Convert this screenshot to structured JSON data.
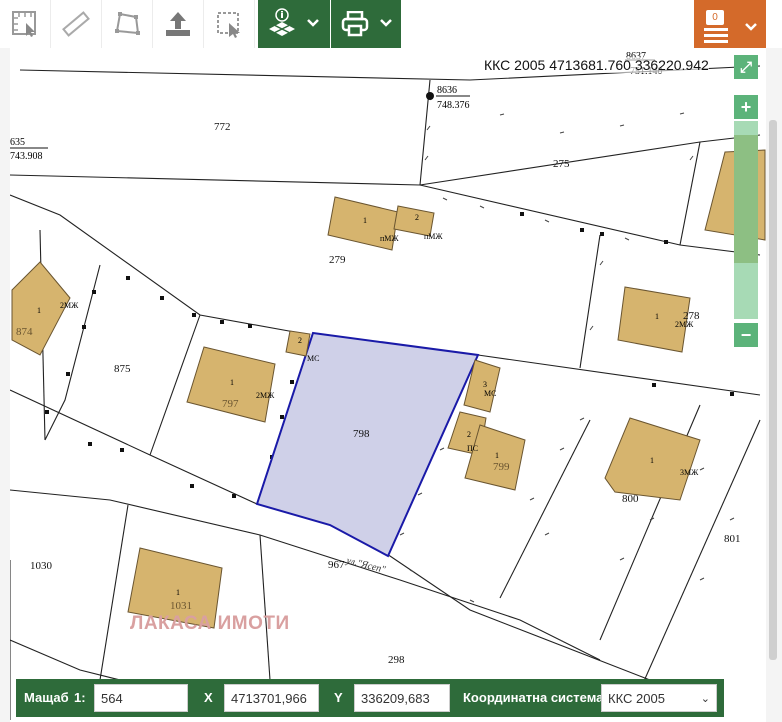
{
  "toolbar": {
    "notification_count": "0",
    "icons": [
      "measure-area-icon",
      "ruler-icon",
      "polygon-icon",
      "upload-icon",
      "select-icon",
      "layers-info-icon",
      "print-icon",
      "menu-icon"
    ]
  },
  "coordinates_readout": "ККС 2005 4713681.760 336220.942",
  "watermark": "ЛАКАСА ИМОТИ",
  "map": {
    "highlighted_parcel": "798",
    "parcel_labels": [
      "772",
      "275",
      "279",
      "875",
      "874",
      "797",
      "798",
      "799",
      "800",
      "801",
      "278",
      "1030",
      "1031",
      "967",
      "298"
    ],
    "building_labels": [
      "1",
      "2",
      "2МЖ",
      "пМЖ",
      "МС",
      "3",
      "ПС",
      "3МЖ"
    ],
    "point_labels": [
      {
        "id": "8636",
        "value": "748.376"
      },
      {
        "id": "635",
        "value": "743.908"
      },
      {
        "id": "8637",
        "value": "751.140"
      }
    ],
    "street_label": "ул.\"Ясеп\"",
    "colors": {
      "parcel_fill": "#cfd0e8",
      "parcel_stroke": "#1a1aa8",
      "building_fill": "#d6b46e",
      "building_stroke": "#6a5530"
    }
  },
  "bottom_bar": {
    "scale_label": "Мащаб",
    "scale_prefix": "1:",
    "scale_value": "564",
    "x_label": "X",
    "x_value": "4713701,966",
    "y_label": "Y",
    "y_value": "336209,683",
    "crs_label": "Координатна система",
    "crs_value": "ККС 2005"
  }
}
